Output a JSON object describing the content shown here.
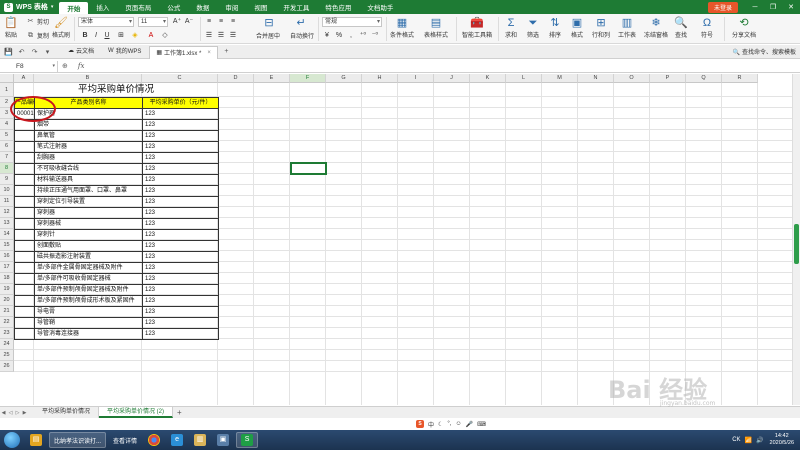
{
  "app": {
    "name": "WPS 表格",
    "menu_tabs": [
      {
        "label": "开始",
        "active": true
      },
      {
        "label": "插入",
        "active": false
      },
      {
        "label": "页面布局",
        "active": false
      },
      {
        "label": "公式",
        "active": false
      },
      {
        "label": "数据",
        "active": false
      },
      {
        "label": "审阅",
        "active": false
      },
      {
        "label": "视图",
        "active": false
      },
      {
        "label": "开发工具",
        "active": false
      },
      {
        "label": "特色应用",
        "active": false
      },
      {
        "label": "文档助手",
        "active": false
      }
    ],
    "login_label": "未登录",
    "brand_color": "#1e7b34"
  },
  "ribbon": {
    "paste": "粘贴",
    "cut": "剪切",
    "copy": "复制",
    "format_painter": "格式刷",
    "font_name": "宋体",
    "font_size": "11",
    "number_format": "常规",
    "merge_center": "合并居中",
    "wrap_text": "自动换行",
    "conditional_format": "条件格式",
    "table_style": "表格样式",
    "smart_toolbox": "智能工具箱",
    "sum": "求和",
    "filter": "筛选",
    "sort": "排序",
    "format": "格式",
    "row_col": "行和列",
    "worksheet": "工作表",
    "freeze": "冻结窗格",
    "find": "查找",
    "symbol": "符号",
    "share": "分享文档"
  },
  "doc_tabs": [
    {
      "label": "云文档",
      "active": false
    },
    {
      "label": "我的WPS",
      "active": false
    },
    {
      "label": "工作簿1.xlsx *",
      "active": true
    }
  ],
  "search_cmd": "查找命令、搜索模板",
  "formula_bar": {
    "name_box": "F8",
    "fx": "fx",
    "content": ""
  },
  "grid": {
    "columns": [
      "A",
      "B",
      "C",
      "D",
      "E",
      "F",
      "G",
      "H",
      "I",
      "J",
      "K",
      "L",
      "M",
      "N",
      "O",
      "P",
      "Q",
      "R"
    ],
    "selected_col": "F",
    "selected_row": 8,
    "row_count": 26,
    "title": "平均采购单价情况",
    "headers": [
      "产品编码",
      "产品类别名称",
      "平均采购单价（元/件）"
    ],
    "first_code": "00001",
    "rows": [
      {
        "name": "保护器",
        "price": "123"
      },
      {
        "name": "烟带",
        "price": "123"
      },
      {
        "name": "鼻氧管",
        "price": "123"
      },
      {
        "name": "笔式注射器",
        "price": "123"
      },
      {
        "name": "刮胸器",
        "price": "123"
      },
      {
        "name": "不可吸收缝合线",
        "price": "123"
      },
      {
        "name": "材料输送器具",
        "price": "123"
      },
      {
        "name": "持续正压通气用面罩、口罩、鼻罩",
        "price": "123"
      },
      {
        "name": "穿刺定位引导装置",
        "price": "123"
      },
      {
        "name": "穿刺器",
        "price": "123"
      },
      {
        "name": "穿刺器械",
        "price": "123"
      },
      {
        "name": "穿刺针",
        "price": "123"
      },
      {
        "name": "创面敷贴",
        "price": "123"
      },
      {
        "name": "磁共振造影注射装置",
        "price": "123"
      },
      {
        "name": "单/多部件金属骨固定器械及附件",
        "price": "123"
      },
      {
        "name": "单/多部件可吸收骨固定器械",
        "price": "123"
      },
      {
        "name": "单/多部件预制颅骨固定器械及附件",
        "price": "123"
      },
      {
        "name": "单/多部件预制颅骨成形术板及紧固件",
        "price": "123"
      },
      {
        "name": "导电膏",
        "price": "123"
      },
      {
        "name": "导管鞘",
        "price": "123"
      },
      {
        "name": "导管消毒连接器",
        "price": "123"
      }
    ],
    "header_fill": "#ffff00",
    "annotation_color": "#c8161d"
  },
  "sheet_tabs": [
    {
      "label": "平均采购单价情况",
      "active": false
    },
    {
      "label": "平均采购单价情况 (2)",
      "active": true
    }
  ],
  "ime_bar": "中",
  "taskbar": {
    "items": [
      {
        "label": "比纳孝法识读打...",
        "boxed": true
      },
      {
        "label": "查看详情",
        "boxed": false
      }
    ],
    "time": "14:42",
    "date": "2020/5/26",
    "tray_text": "CK"
  },
  "watermark": {
    "text": "Bai 经验",
    "sub": "jingyan.baidu.com"
  }
}
